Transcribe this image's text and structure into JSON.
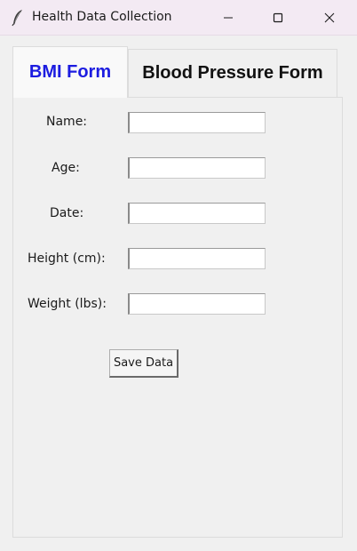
{
  "window": {
    "title": "Health Data Collection"
  },
  "tabs": [
    {
      "label": "BMI Form",
      "active": true
    },
    {
      "label": "Blood Pressure Form",
      "active": false
    }
  ],
  "form": {
    "fields": [
      {
        "label": "Name:",
        "value": ""
      },
      {
        "label": "Age:",
        "value": ""
      },
      {
        "label": "Date:",
        "value": ""
      },
      {
        "label": "Height (cm):",
        "value": ""
      },
      {
        "label": "Weight (lbs):",
        "value": ""
      }
    ],
    "save_label": "Save Data"
  },
  "colors": {
    "active_tab_text": "#1c1ce0",
    "titlebar_bg": "#f3eaf3"
  }
}
